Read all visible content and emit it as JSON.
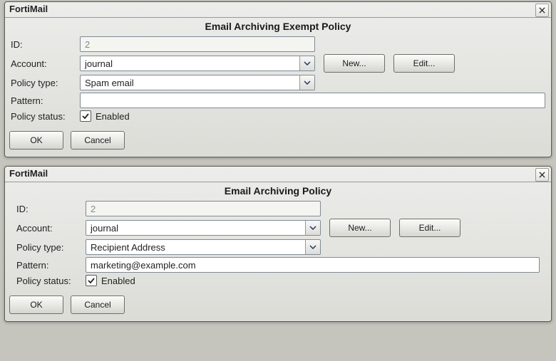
{
  "windows": [
    {
      "title": "FortiMail",
      "close_label": "×",
      "heading": "Email Archiving Exempt Policy",
      "form": {
        "id_label": "ID:",
        "id_value": "2",
        "account_label": "Account:",
        "account_value": "journal",
        "new_label": "New...",
        "edit_label": "Edit...",
        "policy_type_label": "Policy type:",
        "policy_type_value": "Spam email",
        "pattern_label": "Pattern:",
        "pattern_value": "",
        "status_label": "Policy status:",
        "status_checked": true,
        "status_text": "Enabled",
        "ok_label": "OK",
        "cancel_label": "Cancel"
      }
    },
    {
      "title": "FortiMail",
      "close_label": "×",
      "heading": "Email Archiving Policy",
      "form": {
        "id_label": "ID:",
        "id_value": "2",
        "account_label": "Account:",
        "account_value": "journal",
        "new_label": "New...",
        "edit_label": "Edit...",
        "policy_type_label": "Policy type:",
        "policy_type_value": "Recipient Address",
        "pattern_label": "Pattern:",
        "pattern_value": "marketing@example.com",
        "status_label": "Policy status:",
        "status_checked": true,
        "status_text": "Enabled",
        "ok_label": "OK",
        "cancel_label": "Cancel"
      }
    }
  ]
}
